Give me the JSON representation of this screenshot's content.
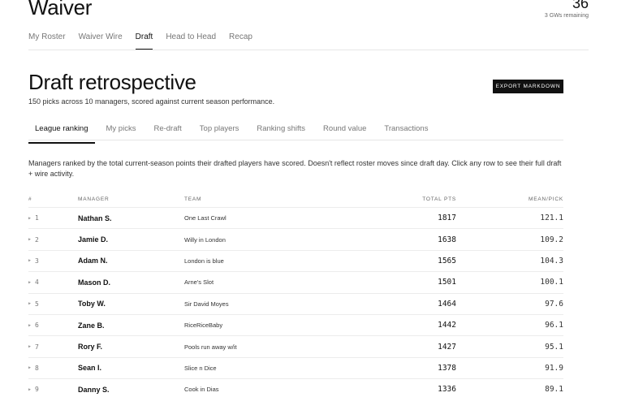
{
  "header": {
    "title": "Waiver",
    "gw_count": "36",
    "gw_remaining": "3 GWs remaining"
  },
  "nav": {
    "tabs": [
      {
        "label": "My Roster"
      },
      {
        "label": "Waiver Wire"
      },
      {
        "label": "Draft"
      },
      {
        "label": "Head to Head"
      },
      {
        "label": "Recap"
      }
    ],
    "active": "Draft"
  },
  "page": {
    "title": "Draft retrospective",
    "subtitle": "150 picks across 10 managers, scored against current season performance.",
    "export_label": "EXPORT MARKDOWN"
  },
  "subnav": {
    "tabs": [
      {
        "label": "League ranking"
      },
      {
        "label": "My picks"
      },
      {
        "label": "Re-draft"
      },
      {
        "label": "Top players"
      },
      {
        "label": "Ranking shifts"
      },
      {
        "label": "Round value"
      },
      {
        "label": "Transactions"
      }
    ],
    "active": "League ranking"
  },
  "description": "Managers ranked by the total current-season points their drafted players have scored. Doesn't reflect roster moves since draft day. Click any row to see their full draft + wire activity.",
  "table": {
    "headers": {
      "rank": "#",
      "manager": "MANAGER",
      "team": "TEAM",
      "total": "TOTAL PTS",
      "mean": "MEAN/PICK"
    },
    "rows": [
      {
        "rank": "1",
        "manager": "Nathan S.",
        "team": "One Last Crawl",
        "total": "1817",
        "mean": "121.1"
      },
      {
        "rank": "2",
        "manager": "Jamie D.",
        "team": "Willy in London",
        "total": "1638",
        "mean": "109.2"
      },
      {
        "rank": "3",
        "manager": "Adam N.",
        "team": "London is blue",
        "total": "1565",
        "mean": "104.3"
      },
      {
        "rank": "4",
        "manager": "Mason D.",
        "team": "Arne's Slot",
        "total": "1501",
        "mean": "100.1"
      },
      {
        "rank": "5",
        "manager": "Toby W.",
        "team": "Sir David Moyes",
        "total": "1464",
        "mean": "97.6"
      },
      {
        "rank": "6",
        "manager": "Zane B.",
        "team": "RiceRiceBaby",
        "total": "1442",
        "mean": "96.1"
      },
      {
        "rank": "7",
        "manager": "Rory F.",
        "team": "Pools run away w/it",
        "total": "1427",
        "mean": "95.1"
      },
      {
        "rank": "8",
        "manager": "Sean I.",
        "team": "Slice n Dice",
        "total": "1378",
        "mean": "91.9"
      },
      {
        "rank": "9",
        "manager": "Danny S.",
        "team": "Cook in Dias",
        "total": "1336",
        "mean": "89.1"
      }
    ]
  }
}
